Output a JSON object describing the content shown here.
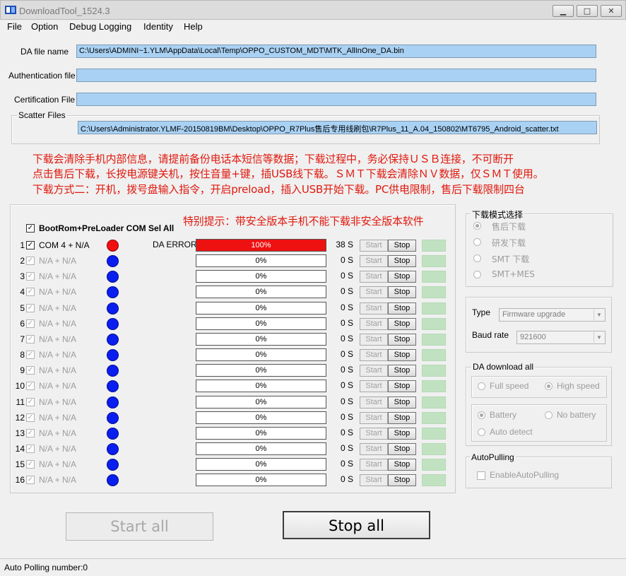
{
  "window": {
    "title": "DownloadTool_1524.3",
    "min_glyph": "▁",
    "max_glyph": "□",
    "close_glyph": "✕"
  },
  "menu": [
    "File",
    "Option",
    "Debug Logging",
    "Identity",
    "Help"
  ],
  "files": {
    "da_label": "DA file name",
    "da_value": "C:\\Users\\ADMINI~1.YLM\\AppData\\Local\\Temp\\OPPO_CUSTOM_MDT\\MTK_AllInOne_DA.bin",
    "auth_label": "Authentication file",
    "auth_value": "",
    "cert_label": "Certification File",
    "cert_value": "",
    "scatter_label": "Scatter Files",
    "scatter_value": "C:\\Users\\Administrator.YLMF-20150819BM\\Desktop\\OPPO_R7Plus售后专用线刷包\\R7Plus_11_A.04_150802\\MT6795_Android_scatter.txt"
  },
  "notice": [
    "下载会清除手机内部信息，请提前备份电话本短信等数据；下载过程中，务必保持ＵＳＢ连接，不可断开",
    "点击售后下载，长按电源键关机，按住音量+键，插USB线下载。ＳＭＴ下载会清除ＮＶ数据，仅ＳＭＴ使用。",
    "下载方式二：开机，拨号盘输入指令，开启preload，插入USB开始下载。PC供电限制，售后下载限制四台"
  ],
  "special_notice": "特别提示：带安全版本手机不能下载非安全版本软件",
  "sel_all_label": "BootRom+PreLoader COM Sel All",
  "start_label": "Start",
  "stop_label": "Stop",
  "ports": [
    {
      "num": "1",
      "port": "COM 4 + N/A",
      "status": "DA ERROR",
      "progress": "100%",
      "progress_value": 100,
      "time": "38 S",
      "active": true,
      "dot": "red"
    },
    {
      "num": "2",
      "port": "N/A + N/A",
      "status": "",
      "progress": "0%",
      "progress_value": 0,
      "time": "0 S",
      "active": false,
      "dot": "blue"
    },
    {
      "num": "3",
      "port": "N/A + N/A",
      "status": "",
      "progress": "0%",
      "progress_value": 0,
      "time": "0 S",
      "active": false,
      "dot": "blue"
    },
    {
      "num": "4",
      "port": "N/A + N/A",
      "status": "",
      "progress": "0%",
      "progress_value": 0,
      "time": "0 S",
      "active": false,
      "dot": "blue"
    },
    {
      "num": "5",
      "port": "N/A + N/A",
      "status": "",
      "progress": "0%",
      "progress_value": 0,
      "time": "0 S",
      "active": false,
      "dot": "blue"
    },
    {
      "num": "6",
      "port": "N/A + N/A",
      "status": "",
      "progress": "0%",
      "progress_value": 0,
      "time": "0 S",
      "active": false,
      "dot": "blue"
    },
    {
      "num": "7",
      "port": "N/A + N/A",
      "status": "",
      "progress": "0%",
      "progress_value": 0,
      "time": "0 S",
      "active": false,
      "dot": "blue"
    },
    {
      "num": "8",
      "port": "N/A + N/A",
      "status": "",
      "progress": "0%",
      "progress_value": 0,
      "time": "0 S",
      "active": false,
      "dot": "blue"
    },
    {
      "num": "9",
      "port": "N/A + N/A",
      "status": "",
      "progress": "0%",
      "progress_value": 0,
      "time": "0 S",
      "active": false,
      "dot": "blue"
    },
    {
      "num": "10",
      "port": "N/A + N/A",
      "status": "",
      "progress": "0%",
      "progress_value": 0,
      "time": "0 S",
      "active": false,
      "dot": "blue"
    },
    {
      "num": "11",
      "port": "N/A + N/A",
      "status": "",
      "progress": "0%",
      "progress_value": 0,
      "time": "0 S",
      "active": false,
      "dot": "blue"
    },
    {
      "num": "12",
      "port": "N/A + N/A",
      "status": "",
      "progress": "0%",
      "progress_value": 0,
      "time": "0 S",
      "active": false,
      "dot": "blue"
    },
    {
      "num": "13",
      "port": "N/A + N/A",
      "status": "",
      "progress": "0%",
      "progress_value": 0,
      "time": "0 S",
      "active": false,
      "dot": "blue"
    },
    {
      "num": "14",
      "port": "N/A + N/A",
      "status": "",
      "progress": "0%",
      "progress_value": 0,
      "time": "0 S",
      "active": false,
      "dot": "blue"
    },
    {
      "num": "15",
      "port": "N/A + N/A",
      "status": "",
      "progress": "0%",
      "progress_value": 0,
      "time": "0 S",
      "active": false,
      "dot": "blue"
    },
    {
      "num": "16",
      "port": "N/A + N/A",
      "status": "",
      "progress": "0%",
      "progress_value": 0,
      "time": "0 S",
      "active": false,
      "dot": "blue"
    }
  ],
  "mode": {
    "title": "下载模式选择",
    "options": [
      "售后下载",
      "研发下载",
      "SMT 下载",
      "SMT+MES"
    ],
    "selected": 0
  },
  "type_label": "Type",
  "type_value": "Firmware upgrade",
  "baud_label": "Baud rate",
  "baud_value": "921600",
  "da_all": {
    "title": "DA download all",
    "speed": [
      "Full speed",
      "High speed"
    ],
    "speed_selected": 1,
    "battery": [
      "Battery",
      "No battery",
      "Auto detect"
    ],
    "battery_selected": 0
  },
  "autopulling": {
    "title": "AutoPulling",
    "checkbox_label": "EnableAutoPulling",
    "checked": false
  },
  "buttons": {
    "start_all": "Start all",
    "stop_all": "Stop all"
  },
  "status": "Auto Polling number:0",
  "colors": {
    "field_bg": "#a9d1f3",
    "notice": "#e0190e",
    "error_fill": "#ee1111",
    "dot_blue": "#0a1ef0",
    "dot_red": "#f01010",
    "led": "#c0e2c0"
  }
}
